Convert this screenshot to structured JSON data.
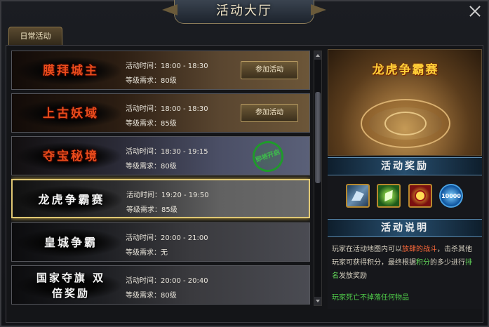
{
  "window": {
    "title": "活动大厅"
  },
  "tabs": [
    {
      "label": "日常活动",
      "active": true
    }
  ],
  "activities": [
    {
      "name": "膜拜城主",
      "time": "活动时间：18:00 - 18:30",
      "level": "等级需求：80级",
      "button": "参加活动",
      "style": "gold",
      "name_color": "red"
    },
    {
      "name": "上古妖域",
      "time": "活动时间：18:00 - 18:30",
      "level": "等级需求：85级",
      "button": "参加活动",
      "style": "gold",
      "name_color": "red"
    },
    {
      "name": "夺宝秘境",
      "time": "活动时间：18:30 - 19:15",
      "level": "等级需求：80级",
      "stamp": "即将开启",
      "style": "blue",
      "name_color": "red"
    },
    {
      "name": "龙虎争霸赛",
      "time": "活动时间：19:20 - 19:50",
      "level": "等级需求：85级",
      "style": "grey",
      "name_color": "white",
      "selected": true
    },
    {
      "name": "皇城争霸",
      "time": "活动时间：20:00 - 21:00",
      "level": "等级需求：无",
      "style": "grey",
      "name_color": "white"
    },
    {
      "name": "国家夺旗 双倍奖励",
      "time": "活动时间：20:00 - 20:40",
      "level": "等级需求：80级",
      "style": "grey",
      "name_color": "white"
    }
  ],
  "detail": {
    "event_title": "龙虎争霸赛",
    "reward_heading": "活动奖励",
    "rewards": [
      {
        "icon": "wing-item-icon",
        "label": ""
      },
      {
        "icon": "green-gem-icon",
        "label": ""
      },
      {
        "icon": "gold-medal-icon",
        "label": ""
      },
      {
        "icon": "blue-orb-icon",
        "label": "10000"
      }
    ],
    "desc_heading": "活动说明",
    "desc_parts": {
      "p1": "玩家在活动地图内可以",
      "p2": "放肆的战斗",
      "p3": "，击杀其他玩家可获得积分，最终根据",
      "p4": "积分",
      "p5": "的多少进行",
      "p6": "排名",
      "p7": "发放奖励"
    },
    "note": "玩家死亡不掉落任何物品"
  },
  "colors": {
    "accent_gold": "#e0c873",
    "highlight_red": "#ff6a3a",
    "highlight_green": "#63d85a"
  }
}
